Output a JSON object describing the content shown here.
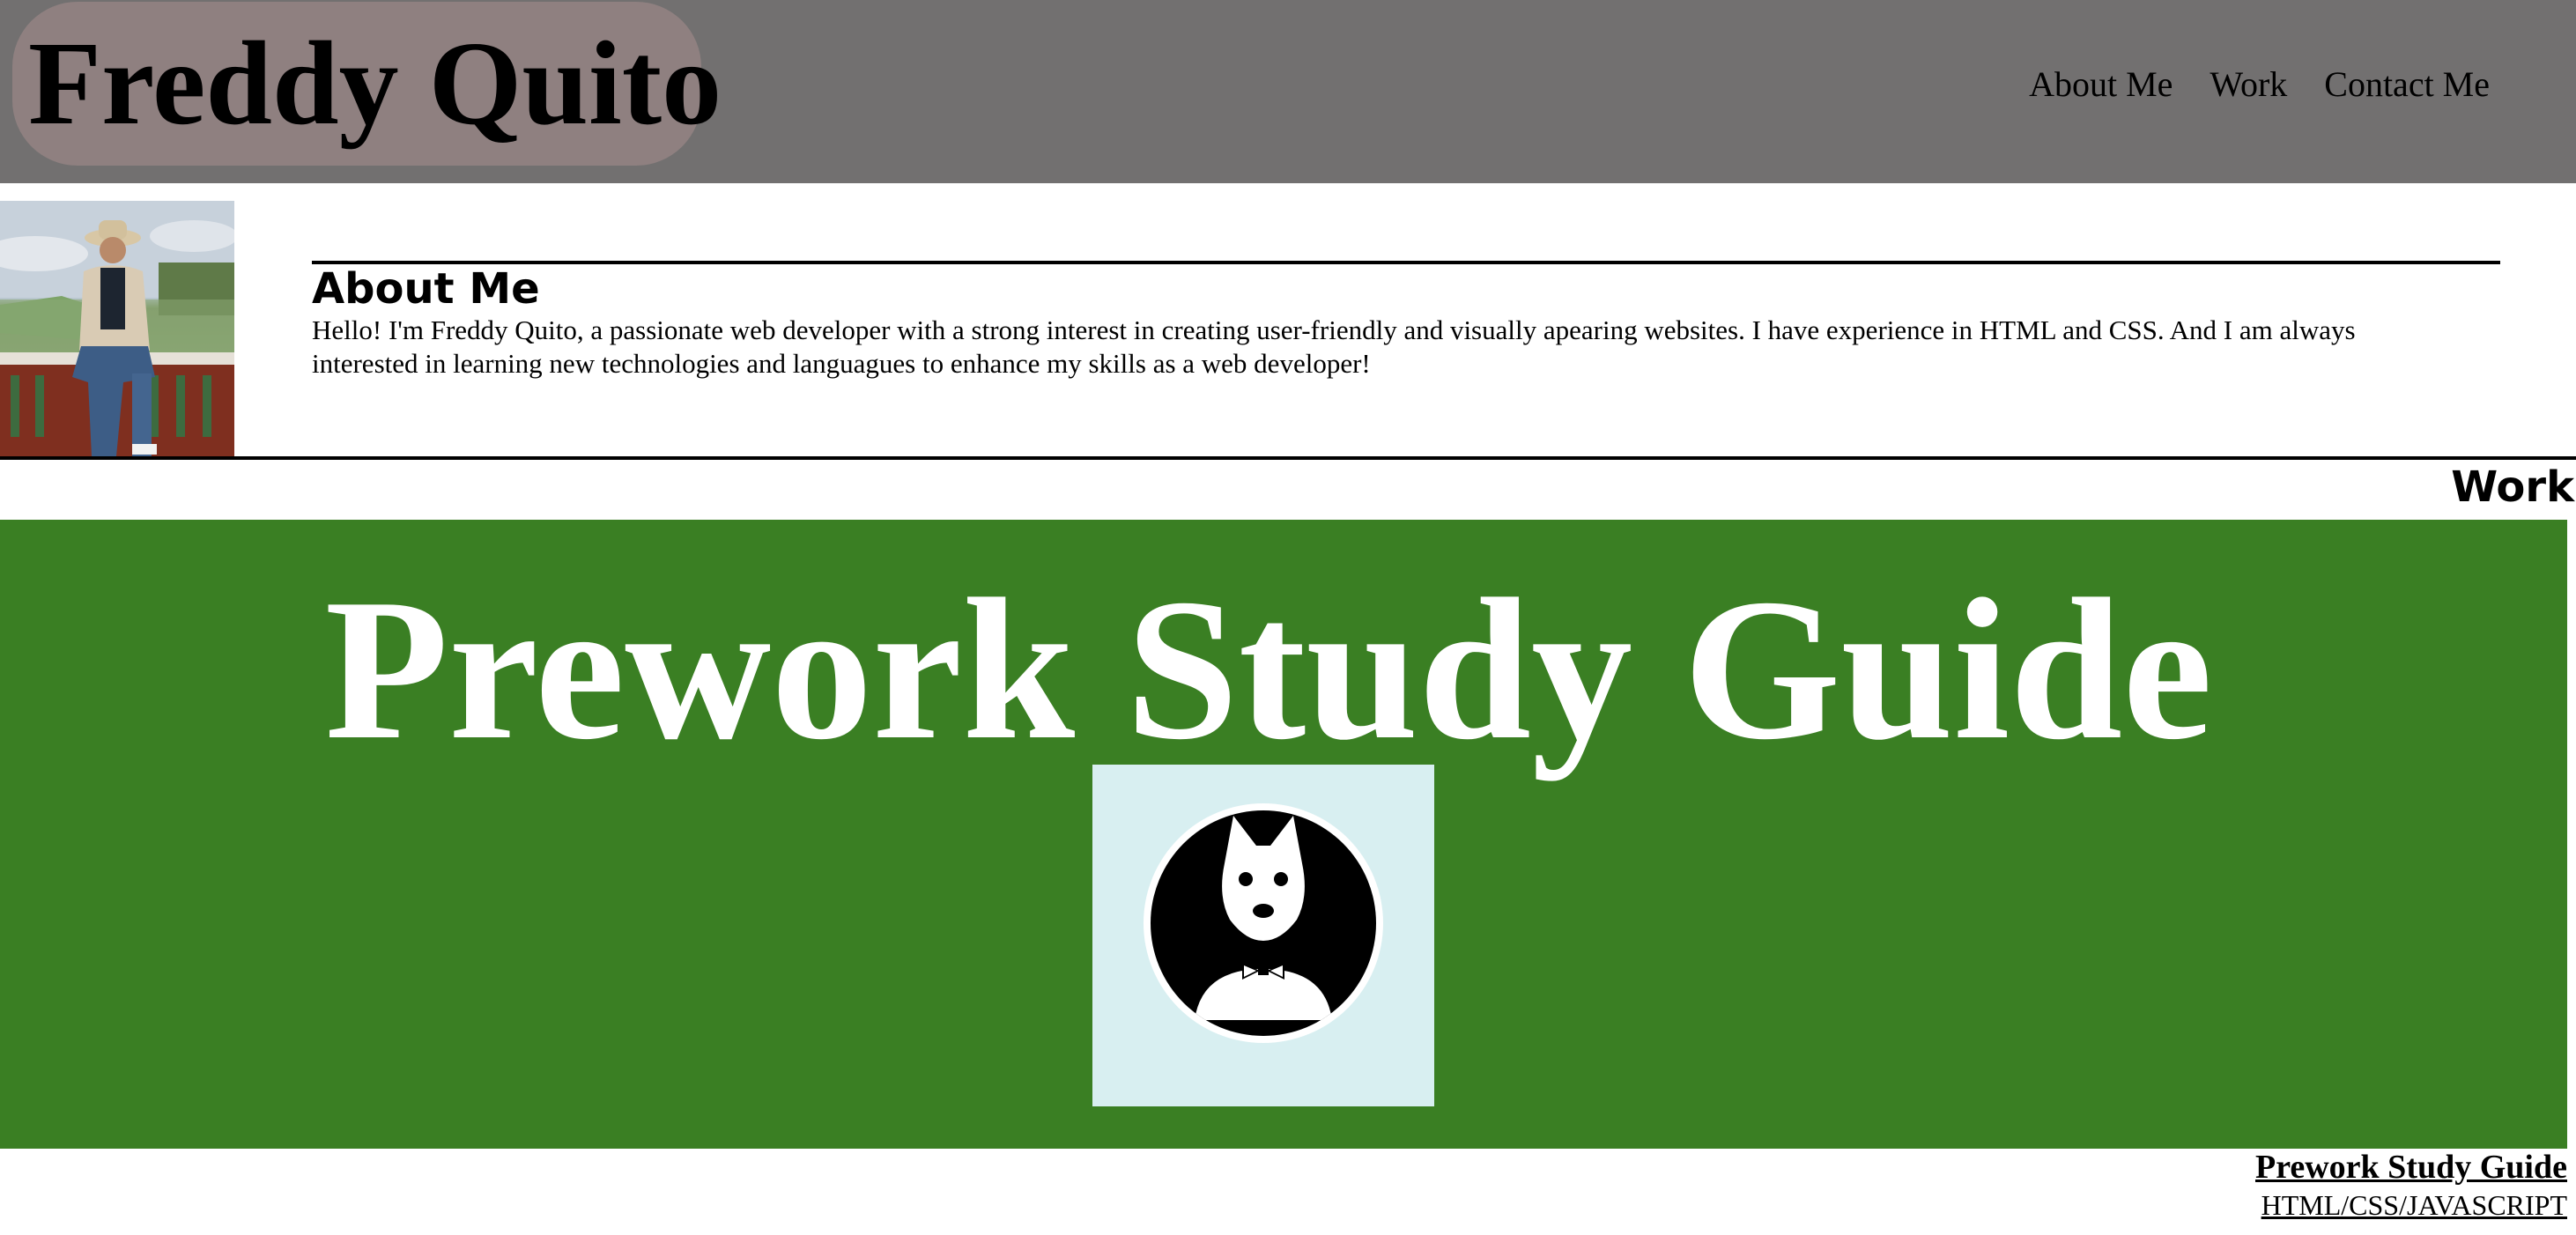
{
  "header": {
    "title": "Freddy Quito",
    "nav": [
      {
        "label": "About Me"
      },
      {
        "label": "Work"
      },
      {
        "label": "Contact Me"
      }
    ]
  },
  "about": {
    "heading": "About Me",
    "text": "Hello! I'm Freddy Quito, a passionate web developer with a strong interest in creating user-friendly and visually apearing websites. I have experience in HTML and CSS. And I am always interested in learning new technologies and languagues to enhance my skills as a web developer!"
  },
  "work": {
    "heading": "Work",
    "projects": [
      {
        "banner_title": "Prework Study Guide",
        "link_label": "Prework Study Guide",
        "tech_label": "HTML/CSS/JAVASCRIPT"
      }
    ]
  },
  "colors": {
    "header_bg": "#727070",
    "brand_pill": "#8f8080",
    "banner_bg": "#3a7f23",
    "logo_bg": "#d8eff1"
  },
  "icons": {
    "profile": "profile-photo",
    "project_logo": "cat-with-bowtie-icon"
  }
}
